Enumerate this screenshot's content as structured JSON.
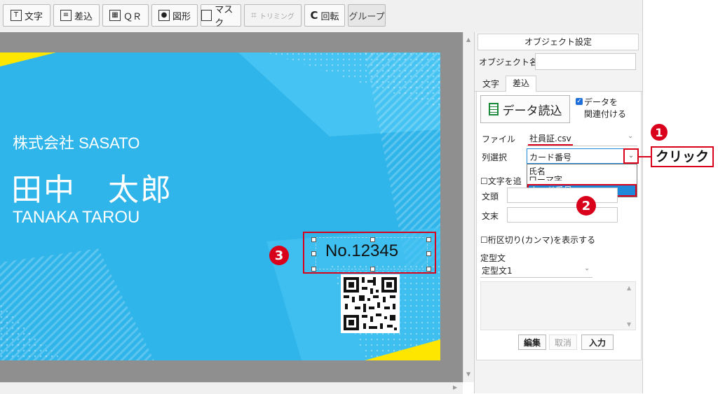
{
  "toolbar": {
    "buttons": [
      {
        "label": "文字",
        "icon": "T"
      },
      {
        "label": "差込",
        "icon": "≡"
      },
      {
        "label": "ＱＲ",
        "icon": "▦"
      },
      {
        "label": "図形",
        "icon": "●"
      },
      {
        "label": "マスク",
        "icon": ""
      },
      {
        "label": "トリミング",
        "icon": "⌗"
      },
      {
        "label": "回転",
        "icon": "C"
      },
      {
        "label": "グループ",
        "icon": ""
      }
    ]
  },
  "card": {
    "company": "株式会社 SASATO",
    "name": "田中　太郎",
    "name_roman": "TANAKA TAROU",
    "number": "No.12345"
  },
  "panel": {
    "header": "オブジェクト設定",
    "object_name_label": "オブジェクト名",
    "tab_text": "文字",
    "tab_merge": "差込",
    "data_read_button": "データ読込",
    "link_data_label_1": "データを",
    "link_data_label_2": "関連付ける",
    "file_label": "ファイル",
    "file_value": "社員証.csv",
    "column_label": "列選択",
    "column_value": "カード番号",
    "dropdown_options": [
      "氏名",
      "ローマ字",
      "カード番号"
    ],
    "add_text_label": "文字を追",
    "prefix_label": "文頭",
    "suffix_label": "文末",
    "thousands_label": "桁区切り(カンマ)を表示する",
    "template_label": "定型文",
    "template_value": "定型文1",
    "edit_button": "編集",
    "cancel_button": "取消",
    "input_button": "入力"
  },
  "annotations": {
    "step1": "1",
    "step2": "2",
    "step3": "3",
    "click_label": "クリック"
  },
  "colors": {
    "card_blue": "#2fb5ea",
    "accent_yellow": "#ffe600",
    "annotation_red": "#d9001b",
    "selection_blue": "#1e88d9"
  }
}
